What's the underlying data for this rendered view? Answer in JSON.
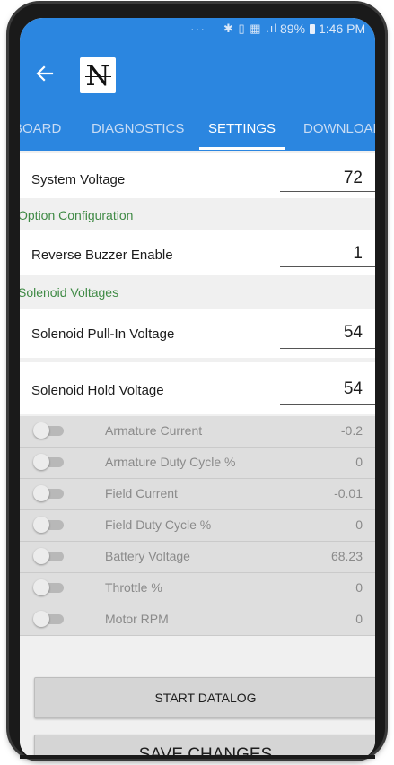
{
  "status_bar": {
    "dots": "···",
    "icons": "✱ ▯ ▦ .ıl",
    "battery": "89%",
    "time": "1:46 PM"
  },
  "toolbar": {
    "back_icon": "arrow-left",
    "logo_letter": "N"
  },
  "tabs": [
    {
      "label": "BOARD",
      "active": false
    },
    {
      "label": "DIAGNOSTICS",
      "active": false
    },
    {
      "label": "SETTINGS",
      "active": true
    },
    {
      "label": "DOWNLOAD",
      "active": false
    }
  ],
  "settings": {
    "system_voltage": {
      "label": "System Voltage",
      "value": "72"
    },
    "option_section": "Option Configuration",
    "reverse_buzzer": {
      "label": "Reverse Buzzer Enable",
      "value": "1"
    },
    "solenoid_section": "Solenoid Voltages",
    "solenoid_pull_in": {
      "label": "Solenoid Pull-In Voltage",
      "value": "54"
    },
    "solenoid_hold": {
      "label": "Solenoid Hold Voltage",
      "value": "54"
    }
  },
  "datalog_channels": [
    {
      "label": "Armature Current",
      "value": "-0.2",
      "enabled": false
    },
    {
      "label": "Armature Duty Cycle %",
      "value": "0",
      "enabled": false
    },
    {
      "label": "Field Current",
      "value": "-0.01",
      "enabled": false
    },
    {
      "label": "Field Duty Cycle %",
      "value": "0",
      "enabled": false
    },
    {
      "label": "Battery Voltage",
      "value": "68.23",
      "enabled": false
    },
    {
      "label": "Throttle %",
      "value": "0",
      "enabled": false
    },
    {
      "label": "Motor RPM",
      "value": "0",
      "enabled": false
    }
  ],
  "buttons": {
    "start_datalog": "START DATALOG",
    "save_changes": "SAVE CHANGES"
  },
  "colors": {
    "app_bar": "#2b86e0",
    "section_header": "#3f8a45",
    "background": "#f0f0f0"
  }
}
